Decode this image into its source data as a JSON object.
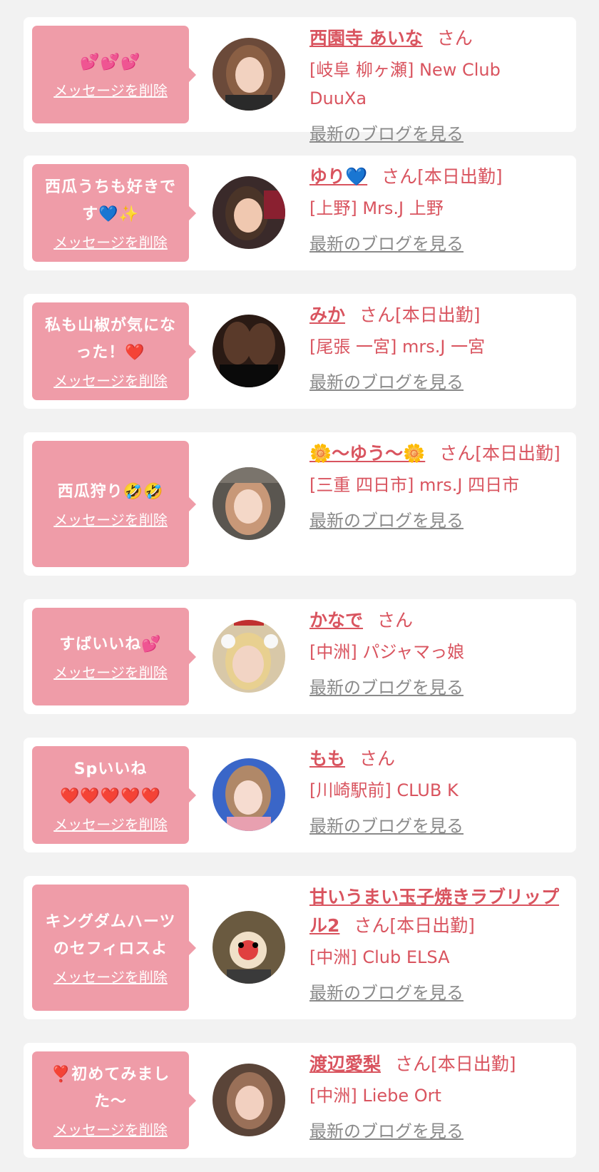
{
  "common": {
    "delete_label": "メッセージを削除",
    "blog_label": "最新のブログを見る",
    "san": "さん"
  },
  "colors": {
    "background": "#f2f2f2",
    "bubble": "#ef9ca8",
    "accent": "#d9545f",
    "link_gray": "#8a8a8a"
  },
  "items": [
    {
      "message_parts": [
        "💕💕💕"
      ],
      "name": "西園寺 あいな",
      "name_suffix": "さん",
      "shop": "[岐阜 柳ヶ瀬] New Club DuuXa",
      "avatar_icon": "woman-portrait-icon"
    },
    {
      "message_parts": [
        "西瓜うちも好きで",
        "す💙✨"
      ],
      "name": "ゆり💙",
      "name_suffix": "さん[本日出勤]",
      "shop": "[上野] Mrs.J 上野",
      "avatar_icon": "woman-portrait-icon"
    },
    {
      "message_parts": [
        "私も山椒が気にな",
        "った！❤️"
      ],
      "name": "みか",
      "name_suffix": "さん[本日出勤]",
      "shop": "[尾張 一宮] mrs.J 一宮",
      "avatar_icon": "legs-photo-icon"
    },
    {
      "message_parts": [
        "西瓜狩り🤣🤣"
      ],
      "name": "🌼〜ゆう〜🌼",
      "name_suffix": "さん[本日出勤]",
      "shop": "[三重 四日市] mrs.J 四日市",
      "avatar_icon": "woman-portrait-icon"
    },
    {
      "message_parts": [
        "すばいいね💕"
      ],
      "name": "かなで",
      "name_suffix": "さん",
      "shop": "[中洲] パジャマっ娘",
      "avatar_icon": "woman-with-bow-icon"
    },
    {
      "message_parts": [
        "Spいいね",
        "❤️❤️❤️❤️❤️"
      ],
      "name": "もも",
      "name_suffix": "さん",
      "shop": "[川崎駅前] CLUB K",
      "avatar_icon": "woman-portrait-icon"
    },
    {
      "message_parts": [
        "キングダムハーツ",
        "のセフィロスよ"
      ],
      "name": "甘いうまい玉子焼きラブリップル2",
      "name_suffix": "さん[本日出勤]",
      "shop": "[中洲] Club ELSA",
      "avatar_icon": "mascot-mask-icon"
    },
    {
      "message_parts": [
        "❣️初めてみまし",
        "た〜"
      ],
      "name": "渡辺愛梨",
      "name_suffix": "さん[本日出勤]",
      "shop": "[中洲] Liebe Ort",
      "avatar_icon": "woman-portrait-icon"
    }
  ]
}
